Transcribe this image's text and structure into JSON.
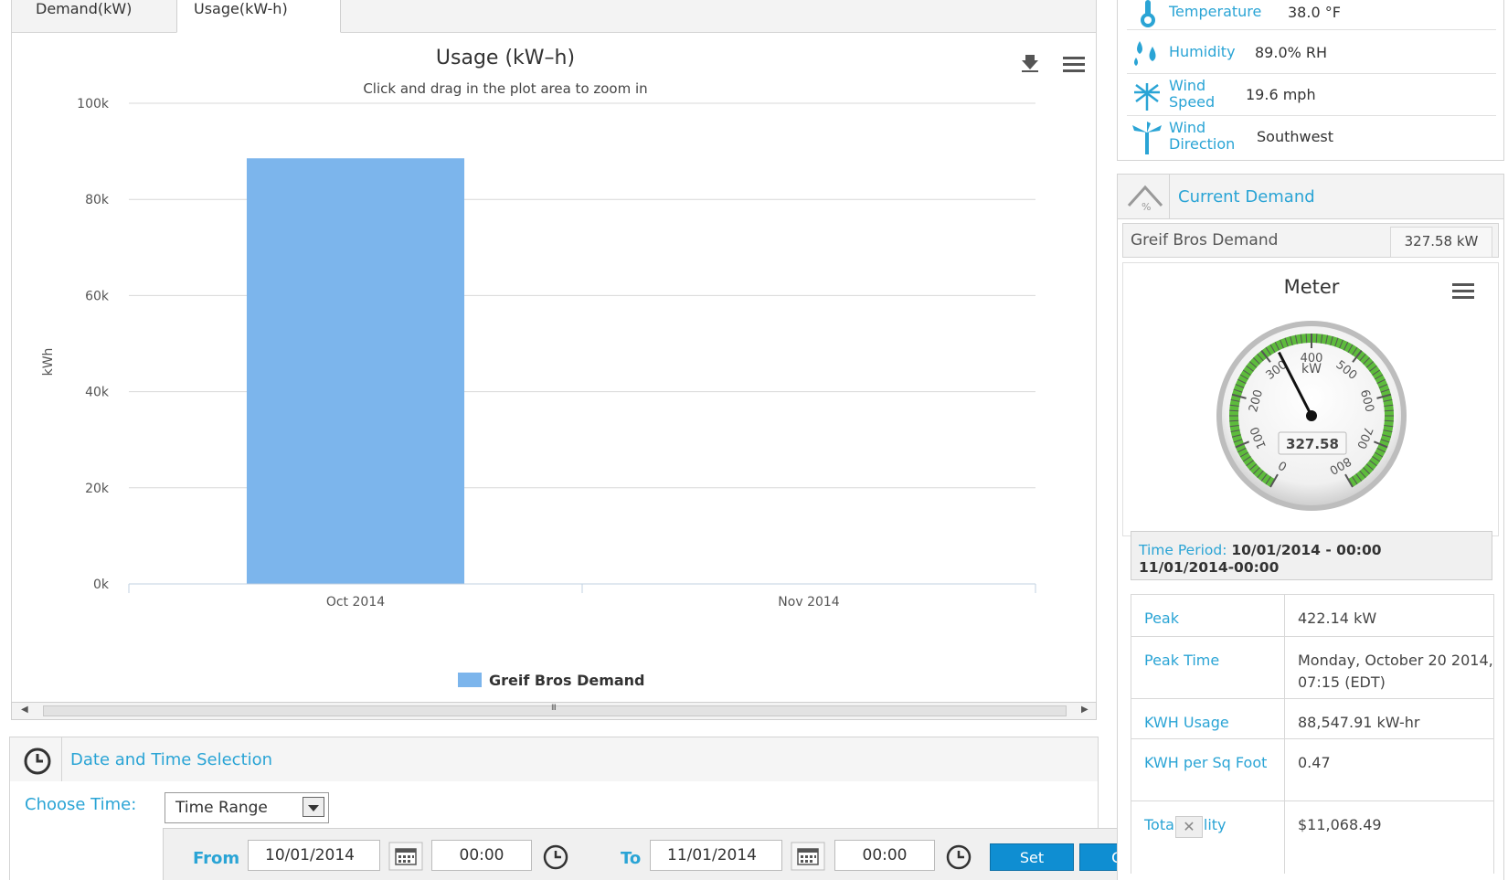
{
  "tabs": [
    {
      "label": "Demand(kW)"
    },
    {
      "label": "Usage(kW-h)"
    }
  ],
  "chart_data": {
    "type": "bar",
    "title": "Usage (kW–h)",
    "subtitle": "Click and drag in the plot area to zoom in",
    "ylabel": "kWh",
    "xlabel": "",
    "categories": [
      "Oct 2014",
      "Nov 2014"
    ],
    "series": [
      {
        "name": "Greif Bros Demand",
        "color": "#7cb5ec",
        "values": [
          88548,
          null
        ]
      }
    ],
    "ylim": [
      0,
      100000
    ],
    "yticks": [
      0,
      20000,
      40000,
      60000,
      80000,
      100000
    ],
    "ytick_labels": [
      "0k",
      "20k",
      "40k",
      "60k",
      "80k",
      "100k"
    ],
    "grid": true,
    "legend": "bottom-center"
  },
  "scrollbar": {
    "thumb_label": "III"
  },
  "date_time": {
    "title": "Date and Time Selection",
    "choose_label": "Choose Time:",
    "choose_value": "Time Range",
    "from_label": "From",
    "from_date": "10/01/2014",
    "from_time": "00:00",
    "to_label": "To",
    "to_date": "11/01/2014",
    "to_time": "00:00",
    "set_label": "Set",
    "clear_label": "Clear"
  },
  "weather": {
    "temperature_label": "Temperature",
    "temperature_value": "38.0 °F",
    "humidity_label": "Humidity",
    "humidity_value": "89.0% RH",
    "wind_speed_label_1": "Wind",
    "wind_speed_label_2": "Speed",
    "wind_speed_value": "19.6 mph",
    "wind_direction_label_1": "Wind",
    "wind_direction_label_2": "Direction",
    "wind_direction_value": "Southwest"
  },
  "current_demand": {
    "title": "Current Demand",
    "meter_name": "Greif Bros Demand",
    "meter_value": "327.58 kW",
    "gauge_title": "Meter",
    "gauge_unit": "kW",
    "gauge_value": 327.58,
    "gauge_value_text": "327.58",
    "gauge_min": 0,
    "gauge_max": 800,
    "gauge_ticks": [
      "0",
      "100",
      "200",
      "300",
      "400",
      "500",
      "600",
      "700",
      "800"
    ],
    "time_period_label": "Time Period:",
    "time_period_start": "10/01/2014 - 00:00",
    "time_period_end": "11/01/2014-00:00"
  },
  "stats": [
    {
      "label": "Peak",
      "value": "422.14 kW"
    },
    {
      "label": "Peak Time",
      "value": "Monday, October 20 2014, 07:15 (EDT)"
    },
    {
      "label": "KWH Usage",
      "value": "88,547.91 kW-hr"
    },
    {
      "label": "KWH per Sq Foot",
      "value": "0.47"
    },
    {
      "label": "Total Utility",
      "value": "$11,068.49"
    }
  ],
  "colors": {
    "accent": "#2aa4d5",
    "bar": "#7cb5ec",
    "button": "#0f8ed2",
    "gauge_band": "#5dbb3c"
  }
}
